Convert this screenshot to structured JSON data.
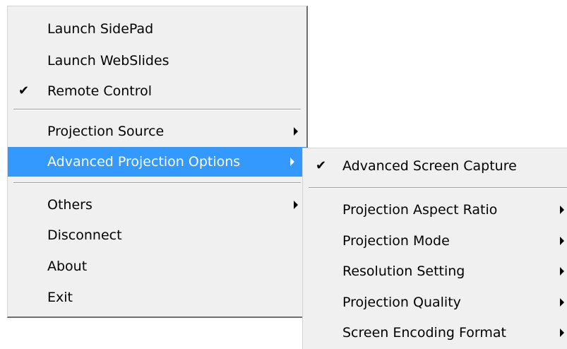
{
  "main_menu": {
    "items": [
      {
        "label": "Launch SidePad",
        "checked": false,
        "has_submenu": false
      },
      {
        "label": "Launch WebSlides",
        "checked": false,
        "has_submenu": false
      },
      {
        "label": "Remote Control",
        "checked": true,
        "has_submenu": false
      },
      {
        "label": "Projection Source",
        "checked": false,
        "has_submenu": true
      },
      {
        "label": "Advanced Projection Options",
        "checked": false,
        "has_submenu": true,
        "highlighted": true
      },
      {
        "label": "Others",
        "checked": false,
        "has_submenu": true
      },
      {
        "label": "Disconnect",
        "checked": false,
        "has_submenu": false
      },
      {
        "label": "About",
        "checked": false,
        "has_submenu": false
      },
      {
        "label": "Exit",
        "checked": false,
        "has_submenu": false
      }
    ],
    "check_glyph": "✔"
  },
  "sub_menu": {
    "items": [
      {
        "label": "Advanced Screen Capture",
        "checked": true,
        "has_submenu": false
      },
      {
        "label": "Projection Aspect Ratio",
        "checked": false,
        "has_submenu": true
      },
      {
        "label": "Projection Mode",
        "checked": false,
        "has_submenu": true
      },
      {
        "label": "Resolution Setting",
        "checked": false,
        "has_submenu": true
      },
      {
        "label": "Projection Quality",
        "checked": false,
        "has_submenu": true
      },
      {
        "label": "Screen Encoding Format",
        "checked": false,
        "has_submenu": true
      }
    ],
    "check_glyph": "✔"
  },
  "colors": {
    "menu_background": "#f0f0f0",
    "highlight": "#3399ff",
    "highlight_text": "#ffffff"
  }
}
